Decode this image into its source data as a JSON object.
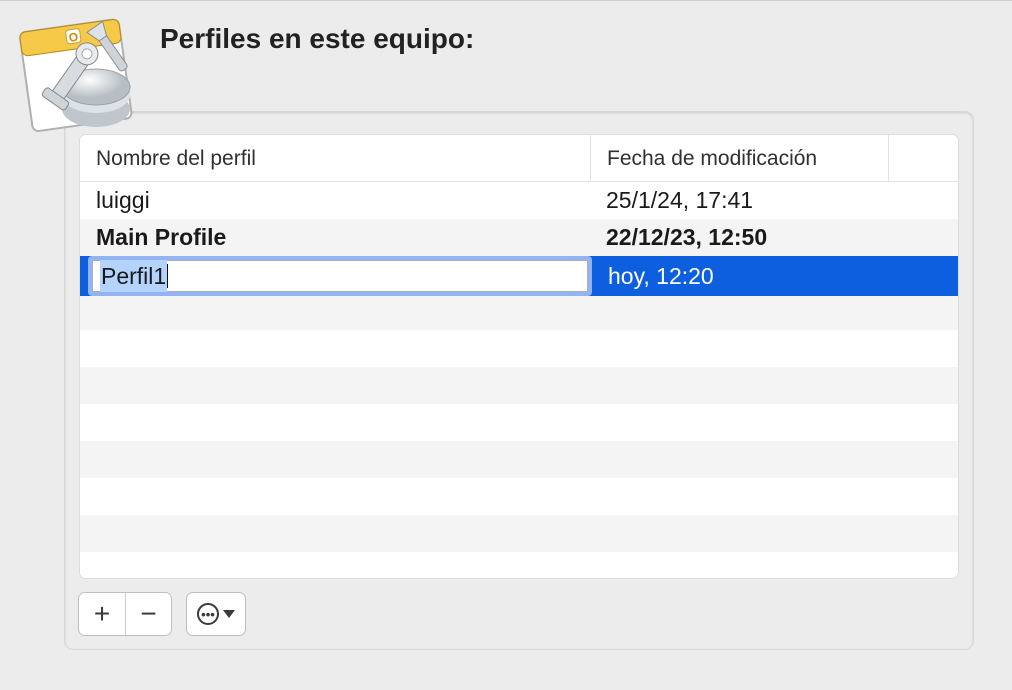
{
  "title": "Perfiles en este equipo:",
  "columns": {
    "name": "Nombre del perfil",
    "date": "Fecha de modificación"
  },
  "rows": [
    {
      "name": "luiggi",
      "date": "25/1/24, 17:41",
      "default": false,
      "selected": false,
      "editing": false
    },
    {
      "name": "Main Profile",
      "date": "22/12/23, 12:50",
      "default": true,
      "selected": false,
      "editing": false
    },
    {
      "name": "Perfil1",
      "date": "hoy, 12:20",
      "default": false,
      "selected": true,
      "editing": true
    }
  ],
  "toolbar": {
    "add": "+",
    "remove": "−",
    "menu": "..."
  }
}
